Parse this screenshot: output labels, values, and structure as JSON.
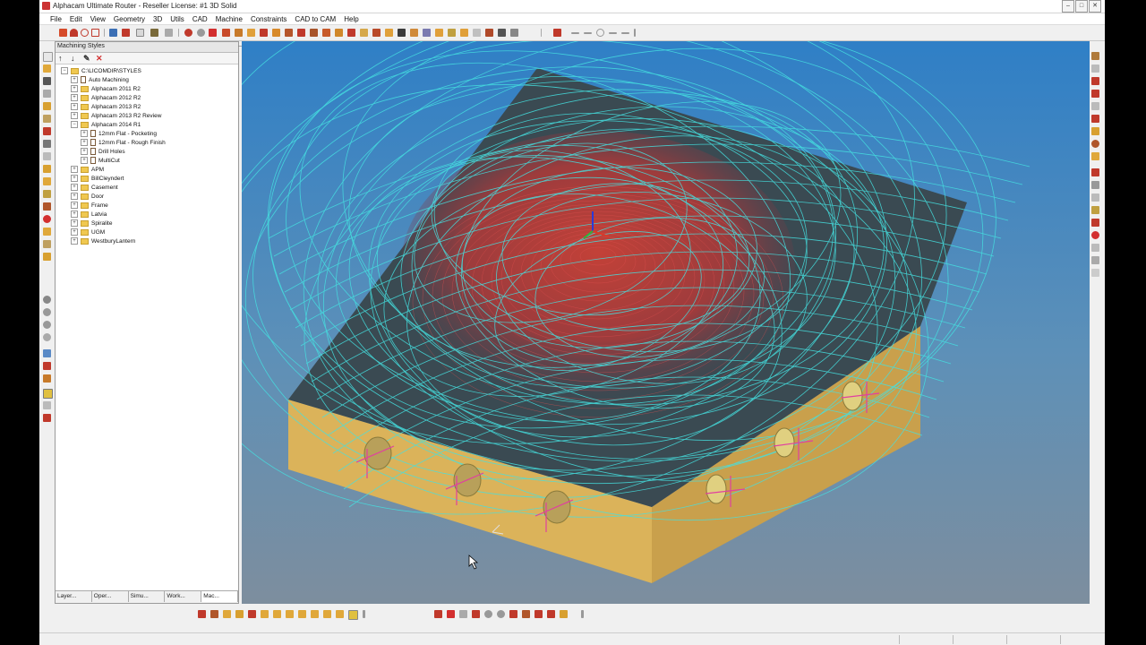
{
  "window": {
    "title": "Alphacam Ultimate Router - Reseller License: #1 3D Solid",
    "minimize": "–",
    "maximize": "□",
    "close": "✕"
  },
  "menu": [
    "File",
    "Edit",
    "View",
    "Geometry",
    "3D",
    "Utils",
    "CAD",
    "Machine",
    "Constraints",
    "CAD to CAM",
    "Help"
  ],
  "panel": {
    "title": "Machining Styles",
    "pin": "⊣",
    "close": "×",
    "tools": {
      "up": "↑",
      "down": "↓",
      "edit": "✎",
      "delete": "✕"
    },
    "tree": [
      {
        "label": "C:\\LICOMDIR\\STYLES",
        "level": 0,
        "type": "folder",
        "expander": "−"
      },
      {
        "label": "Auto Machining",
        "level": 1,
        "type": "doc",
        "expander": "+"
      },
      {
        "label": "Alphacam 2011 R2",
        "level": 1,
        "type": "folder",
        "expander": "+"
      },
      {
        "label": "Alphacam 2012 R2",
        "level": 1,
        "type": "folder",
        "expander": "+"
      },
      {
        "label": "Alphacam 2013 R2",
        "level": 1,
        "type": "folder",
        "expander": "+"
      },
      {
        "label": "Alphacam 2013 R2 Review",
        "level": 1,
        "type": "folder",
        "expander": "+"
      },
      {
        "label": "Alphacam 2014 R1",
        "level": 1,
        "type": "folder",
        "expander": "−"
      },
      {
        "label": "12mm Flat - Pocketing",
        "level": 2,
        "type": "doc",
        "expander": "+"
      },
      {
        "label": "12mm Flat - Rough Finish",
        "level": 2,
        "type": "doc",
        "expander": "+"
      },
      {
        "label": "Drill Holes",
        "level": 2,
        "type": "doc",
        "expander": "+"
      },
      {
        "label": "MultiCut",
        "level": 2,
        "type": "doc",
        "expander": "+"
      },
      {
        "label": "APM",
        "level": 1,
        "type": "folder",
        "expander": "+"
      },
      {
        "label": "BillCleyndert",
        "level": 1,
        "type": "folder",
        "expander": "+"
      },
      {
        "label": "Casement",
        "level": 1,
        "type": "folder",
        "expander": "+"
      },
      {
        "label": "Door",
        "level": 1,
        "type": "folder",
        "expander": "+"
      },
      {
        "label": "Frame",
        "level": 1,
        "type": "folder",
        "expander": "+"
      },
      {
        "label": "Latvia",
        "level": 1,
        "type": "folder",
        "expander": "+"
      },
      {
        "label": "Spiralite",
        "level": 1,
        "type": "folder",
        "expander": "+"
      },
      {
        "label": "UGM",
        "level": 1,
        "type": "folder",
        "expander": "+"
      },
      {
        "label": "WestburyLantern",
        "level": 1,
        "type": "folder",
        "expander": "+"
      }
    ],
    "tabs": [
      "Layer...",
      "Oper...",
      "Simu...",
      "Work...",
      "Mac..."
    ],
    "active_tab": "Mac..."
  },
  "colors": {
    "viewport_top": "#2f7fc6",
    "viewport_bottom": "#7d8e9e",
    "part_top": "#3a4a52",
    "part_front": "#dbb35a",
    "part_side": "#c9a04c",
    "toolpath": "#45e0e0",
    "dome": "#c0362e",
    "hole_mark": "#e040a0"
  },
  "icons": {
    "toolbar": [
      "line-icon",
      "arc-icon",
      "circle-icon",
      "rectangle-icon",
      "text-icon",
      "undo-icon",
      "redo-icon",
      "delete-icon",
      "move-icon",
      "rotate-icon",
      "zoom-icon",
      "snap-icon"
    ],
    "view": [
      "wcs-gizmo-icon"
    ]
  }
}
